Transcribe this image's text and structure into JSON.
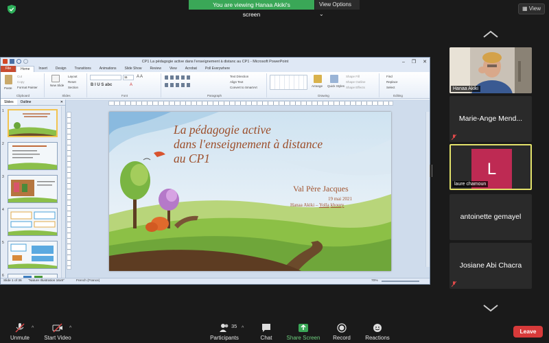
{
  "banner": {
    "viewing": "You are viewing Hanaa Akiki's screen",
    "view_options": "View Options"
  },
  "top_right": {
    "view_label": "View"
  },
  "ppt": {
    "title": "CP1 La pédagogie active  dans l'enseignement à distanc au CP1  -  Microsoft PowerPoint",
    "tabs": [
      "File",
      "Home",
      "Insert",
      "Design",
      "Transitions",
      "Animations",
      "Slide Show",
      "Review",
      "View",
      "Acrobat",
      "Poll Everywhere"
    ],
    "active_tab": "Home",
    "ribbon": {
      "clipboard": {
        "label": "Clipboard",
        "paste": "Paste",
        "cut": "Cut",
        "copy": "Copy",
        "format_painter": "Format Painter"
      },
      "slides": {
        "label": "Slides",
        "new_slide": "New Slide",
        "layout": "Layout",
        "reset": "Reset",
        "section": "Section"
      },
      "font": {
        "label": "Font",
        "size": "11"
      },
      "paragraph": {
        "label": "Paragraph",
        "text_direction": "Text Direction",
        "align_text": "Align Text",
        "convert": "Convert to SmartArt"
      },
      "drawing": {
        "label": "Drawing",
        "arrange": "Arrange",
        "quick_styles": "Quick Styles",
        "shape_fill": "Shape Fill",
        "shape_outline": "Shape Outline",
        "shape_effects": "Shape Effects"
      },
      "editing": {
        "label": "Editing",
        "find": "Find",
        "replace": "Replace",
        "select": "Select"
      }
    },
    "pane_tabs": {
      "slides": "Slides",
      "outline": "Outline"
    },
    "thumb_numbers": [
      "1",
      "2",
      "3",
      "4",
      "5",
      "6"
    ],
    "slide": {
      "title_lines": [
        "La pédagogie active",
        "dans l'enseignement à distance",
        "au CP1"
      ],
      "author": "Val Père Jacques",
      "date": "19 mai 2021",
      "names_prefix": "Hanaa Akiki  – ",
      "names_u1": "Yolla",
      "names_u2": "khoury"
    },
    "status": {
      "slide_of": "Slide 1 of 36",
      "theme": "\"Nature Illustration 16x9\"",
      "language": "French (France)",
      "zoom": "70%"
    }
  },
  "participants": [
    {
      "name": "Hanaa Akiki",
      "type": "video"
    },
    {
      "name": "Marie-Ange Mend...",
      "type": "name",
      "muted": true
    },
    {
      "name": "laure chamoun",
      "type": "avatar",
      "initial": "L",
      "active": true
    },
    {
      "name": "antoinette gemayel",
      "type": "name"
    },
    {
      "name": "Josiane Abi Chacra",
      "type": "name",
      "muted": true
    }
  ],
  "toolbar": {
    "unmute": "Unmute",
    "start_video": "Start Video",
    "participants": "Participants",
    "participant_count": "35",
    "chat": "Chat",
    "share_screen": "Share Screen",
    "record": "Record",
    "reactions": "Reactions",
    "leave": "Leave"
  },
  "colors": {
    "share_green": "#3aa757",
    "leave_red": "#d73a3a",
    "avatar_red": "#be2a53",
    "active_border": "#e4e36b"
  }
}
